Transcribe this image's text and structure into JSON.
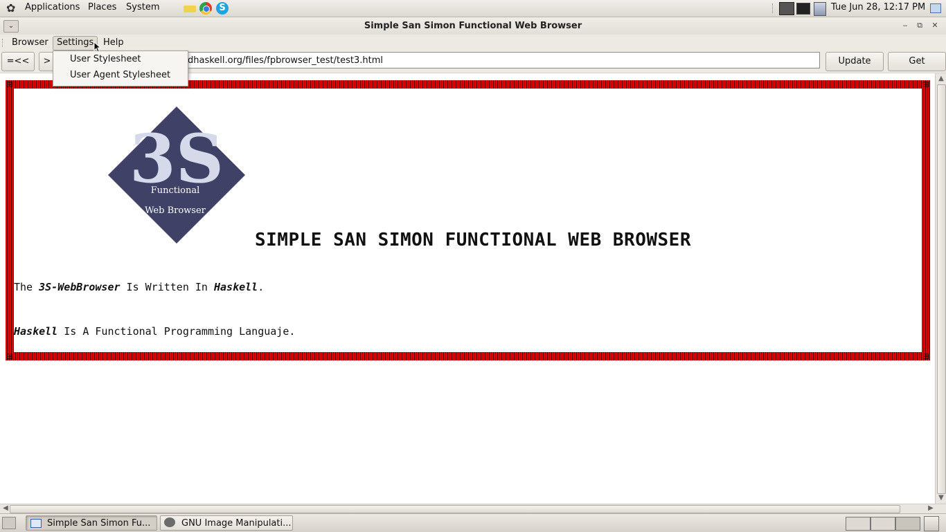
{
  "top_panel": {
    "menus": [
      "Applications",
      "Places",
      "System"
    ],
    "clock": "Tue Jun 28, 12:17 PM",
    "launchers": [
      "folder-icon",
      "chrome-icon",
      "skype-icon"
    ]
  },
  "window": {
    "title": "Simple San Simon Functional Web Browser"
  },
  "menubar": {
    "items": [
      "Browser",
      "Settings",
      "Help"
    ],
    "open_menu": "Settings"
  },
  "settings_menu": {
    "items": [
      "User Stylesheet",
      "User Agent Stylesheet"
    ]
  },
  "toolbar": {
    "back_label": "=<<",
    "forward_label": ">",
    "url": "dhaskell.org/files/fpbrowser_test/test3.html",
    "update_label": "Update",
    "get_label": "Get"
  },
  "page": {
    "logo": {
      "text": "3S",
      "line1": "Functional",
      "line2": "Web Browser"
    },
    "heading": "SIMPLE SAN SIMON FUNCTIONAL WEB BROWSER",
    "paragraph1": {
      "prefix": "The ",
      "em1": "3S-WebBrowser",
      "mid": " Is Written In ",
      "em2": "Haskell",
      "suffix": "."
    },
    "paragraph2": {
      "em": "Haskell",
      "rest": " Is A Functional Programming Languaje."
    }
  },
  "taskbar": {
    "tasks": [
      "Simple San Simon Fu...",
      "GNU Image Manipulati..."
    ]
  },
  "colors": {
    "logo_fill": "#3f4166",
    "logo_text": "#d5d9ea",
    "frame_red": "#e40000"
  }
}
